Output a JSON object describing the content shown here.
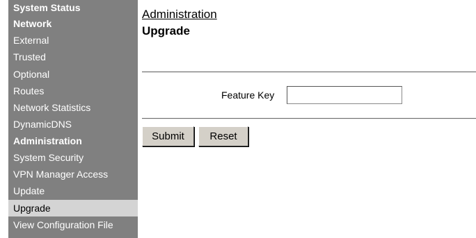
{
  "sidebar": {
    "items": [
      {
        "label": "System Status",
        "kind": "header"
      },
      {
        "label": "Network",
        "kind": "header"
      },
      {
        "label": "External",
        "kind": "sub"
      },
      {
        "label": "Trusted",
        "kind": "sub"
      },
      {
        "label": "Optional",
        "kind": "sub"
      },
      {
        "label": "Routes",
        "kind": "sub"
      },
      {
        "label": "Network Statistics",
        "kind": "sub"
      },
      {
        "label": "DynamicDNS",
        "kind": "sub"
      },
      {
        "label": "Administration",
        "kind": "header"
      },
      {
        "label": "System Security",
        "kind": "sub"
      },
      {
        "label": "VPN Manager Access",
        "kind": "sub"
      },
      {
        "label": "Update",
        "kind": "sub"
      },
      {
        "label": "Upgrade",
        "kind": "sub",
        "active": true
      },
      {
        "label": "View Configuration File",
        "kind": "sub"
      }
    ]
  },
  "main": {
    "breadcrumb": "Administration",
    "title": "Upgrade",
    "form": {
      "feature_key_label": "Feature Key",
      "feature_key_value": ""
    },
    "buttons": {
      "submit_label": "Submit",
      "reset_label": "Reset"
    }
  },
  "colors": {
    "sidebar_bg": "#808080",
    "sidebar_active_bg": "#d4d4d4",
    "button_bg": "#d4d0c8"
  }
}
